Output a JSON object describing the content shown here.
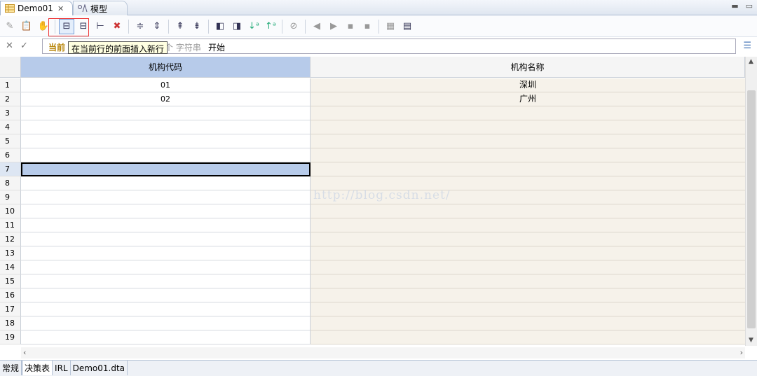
{
  "tabs": {
    "editor_tab": "Demo01",
    "model_tab": "模型"
  },
  "formula": {
    "label": "当前",
    "hint": "个 字符串",
    "value": "开始"
  },
  "tooltip": "在当前行的前面插入新行",
  "columns": [
    "机构代码",
    "机构名称"
  ],
  "rows": [
    {
      "n": "1",
      "code": "01",
      "name": "深圳"
    },
    {
      "n": "2",
      "code": "02",
      "name": "广州"
    },
    {
      "n": "3",
      "code": "",
      "name": ""
    },
    {
      "n": "4",
      "code": "",
      "name": ""
    },
    {
      "n": "5",
      "code": "",
      "name": ""
    },
    {
      "n": "6",
      "code": "",
      "name": ""
    },
    {
      "n": "7",
      "code": "",
      "name": ""
    },
    {
      "n": "8",
      "code": "",
      "name": ""
    },
    {
      "n": "9",
      "code": "",
      "name": ""
    },
    {
      "n": "10",
      "code": "",
      "name": ""
    },
    {
      "n": "11",
      "code": "",
      "name": ""
    },
    {
      "n": "12",
      "code": "",
      "name": ""
    },
    {
      "n": "13",
      "code": "",
      "name": ""
    },
    {
      "n": "14",
      "code": "",
      "name": ""
    },
    {
      "n": "15",
      "code": "",
      "name": ""
    },
    {
      "n": "16",
      "code": "",
      "name": ""
    },
    {
      "n": "17",
      "code": "",
      "name": ""
    },
    {
      "n": "18",
      "code": "",
      "name": ""
    },
    {
      "n": "19",
      "code": "",
      "name": ""
    }
  ],
  "selected_row": "7",
  "watermark": "http://blog.csdn.net/",
  "bottom_tabs": [
    "常规",
    "决策表",
    "IRL",
    "Demo01.dta"
  ],
  "active_bottom_tab": "决策表",
  "colors": {
    "header_selected": "#b7cbea",
    "right_column_bg": "#f6f2ea",
    "highlight_box": "#e33333"
  }
}
